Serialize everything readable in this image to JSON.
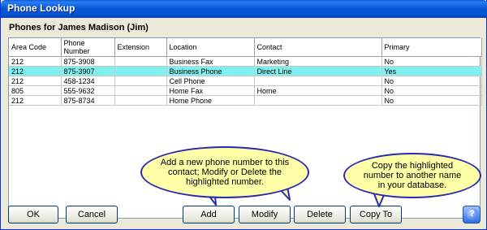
{
  "window": {
    "title": "Phone Lookup"
  },
  "heading": "Phones for James Madison (Jim)",
  "table": {
    "columns": [
      "Area Code",
      "Phone Number",
      "Extension",
      "Location",
      "Contact",
      "Primary"
    ],
    "rows": [
      [
        "212",
        "875-3908",
        "",
        "Business Fax",
        "Marketing",
        "No"
      ],
      [
        "212",
        "875-3907",
        "",
        "Business Phone",
        "Direct Line",
        "Yes"
      ],
      [
        "212",
        "458-1234",
        "",
        "Cell Phone",
        "",
        "No"
      ],
      [
        "805",
        "555-9632",
        "",
        "Home Fax",
        "Home",
        "No"
      ],
      [
        "212",
        "875-8734",
        "",
        "Home Phone",
        "",
        "No"
      ]
    ],
    "selected_row": 1
  },
  "buttons": {
    "ok": "OK",
    "cancel": "Cancel",
    "add": "Add",
    "modify": "Modify",
    "delete": "Delete",
    "copy_to": "Copy To",
    "help": "?"
  },
  "callouts": {
    "add": "Add a new phone number to this contact; Modify or Delete the highlighted number.",
    "copy": "Copy the highlighted number to another name in your database."
  },
  "colors": {
    "selection": "#80f0f0",
    "callout_fill": "#ffffa8",
    "callout_border": "#2a2ab0"
  }
}
